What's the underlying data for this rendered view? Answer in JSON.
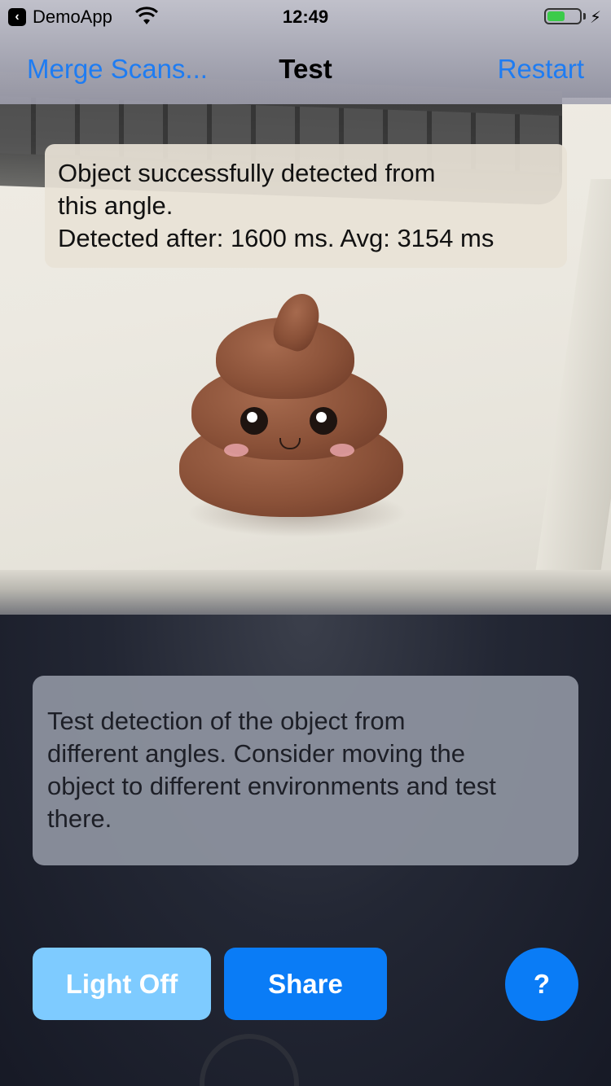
{
  "status_bar": {
    "back_app": "DemoApp",
    "time": "12:49",
    "battery_level": 0.55,
    "battery_color": "#3ccb4a",
    "icons": [
      "wifi-icon",
      "battery-icon",
      "charging-icon"
    ]
  },
  "nav": {
    "left_button": "Merge Scans...",
    "title": "Test",
    "right_button": "Restart",
    "accent_color": "#1e7cf2"
  },
  "detection_message": {
    "line1": "Object successfully detected from",
    "line2": "this angle.",
    "line3": "Detected after: 1600 ms. Avg: 3154 ms"
  },
  "instruction": {
    "line1": "Test detection of the object from",
    "line2": "different angles. Consider moving the",
    "line3": "object to different environments and test",
    "line4": "there."
  },
  "buttons": {
    "light": "Light Off",
    "share": "Share",
    "help": "?"
  }
}
